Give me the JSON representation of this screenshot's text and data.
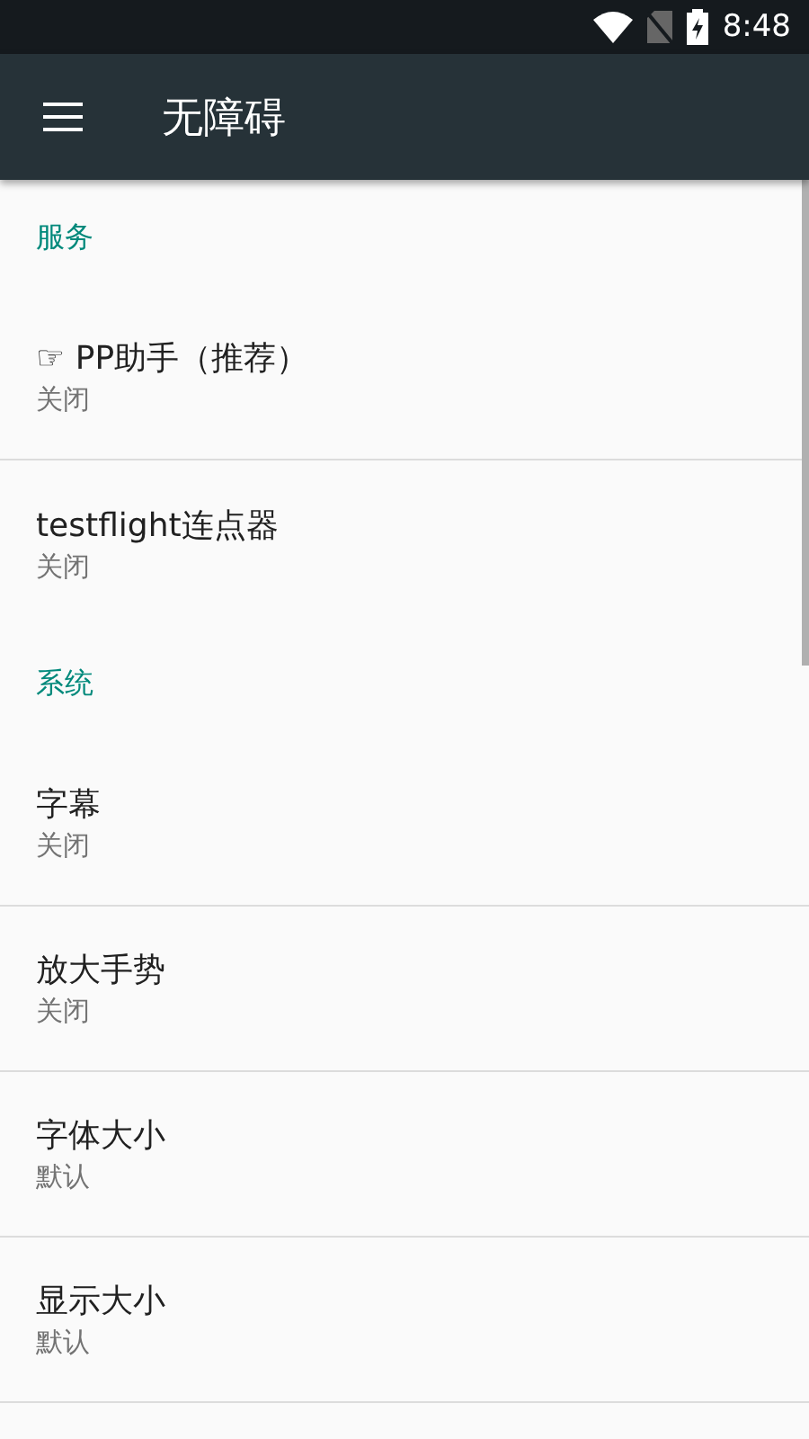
{
  "status_bar": {
    "time": "8:48"
  },
  "app_bar": {
    "title": "无障碍"
  },
  "sections": [
    {
      "header": "服务",
      "items": [
        {
          "title": "☞ PP助手（推荐）",
          "summary": "关闭"
        },
        {
          "title": "testflight连点器",
          "summary": "关闭"
        }
      ]
    },
    {
      "header": "系统",
      "items": [
        {
          "title": "字幕",
          "summary": "关闭"
        },
        {
          "title": "放大手势",
          "summary": "关闭"
        },
        {
          "title": "字体大小",
          "summary": "默认"
        },
        {
          "title": "显示大小",
          "summary": "默认"
        }
      ]
    }
  ]
}
